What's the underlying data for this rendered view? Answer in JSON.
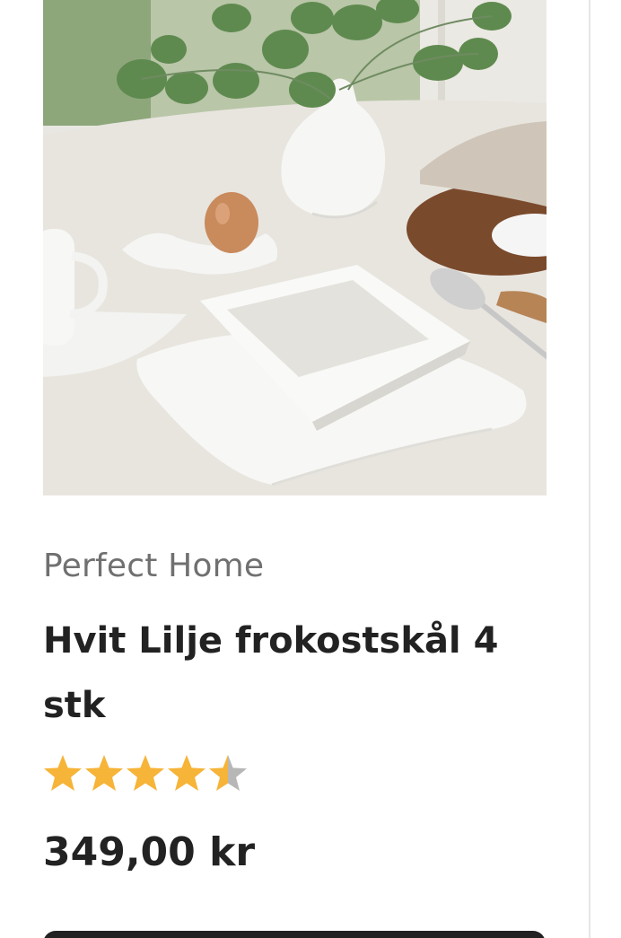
{
  "product": {
    "image_alt": "Hvit Lilje frokostskål 4 stk",
    "brand": "Perfect Home",
    "title": "Hvit Lilje frokostskål 4 stk",
    "rating": {
      "value": 4.5,
      "max": 5,
      "filled_color": "#f6b438",
      "empty_color": "#b7b7b7"
    },
    "price": "349,00 kr"
  },
  "colors": {
    "text_primary": "#222222",
    "text_secondary": "#707070",
    "button": "#222222"
  }
}
